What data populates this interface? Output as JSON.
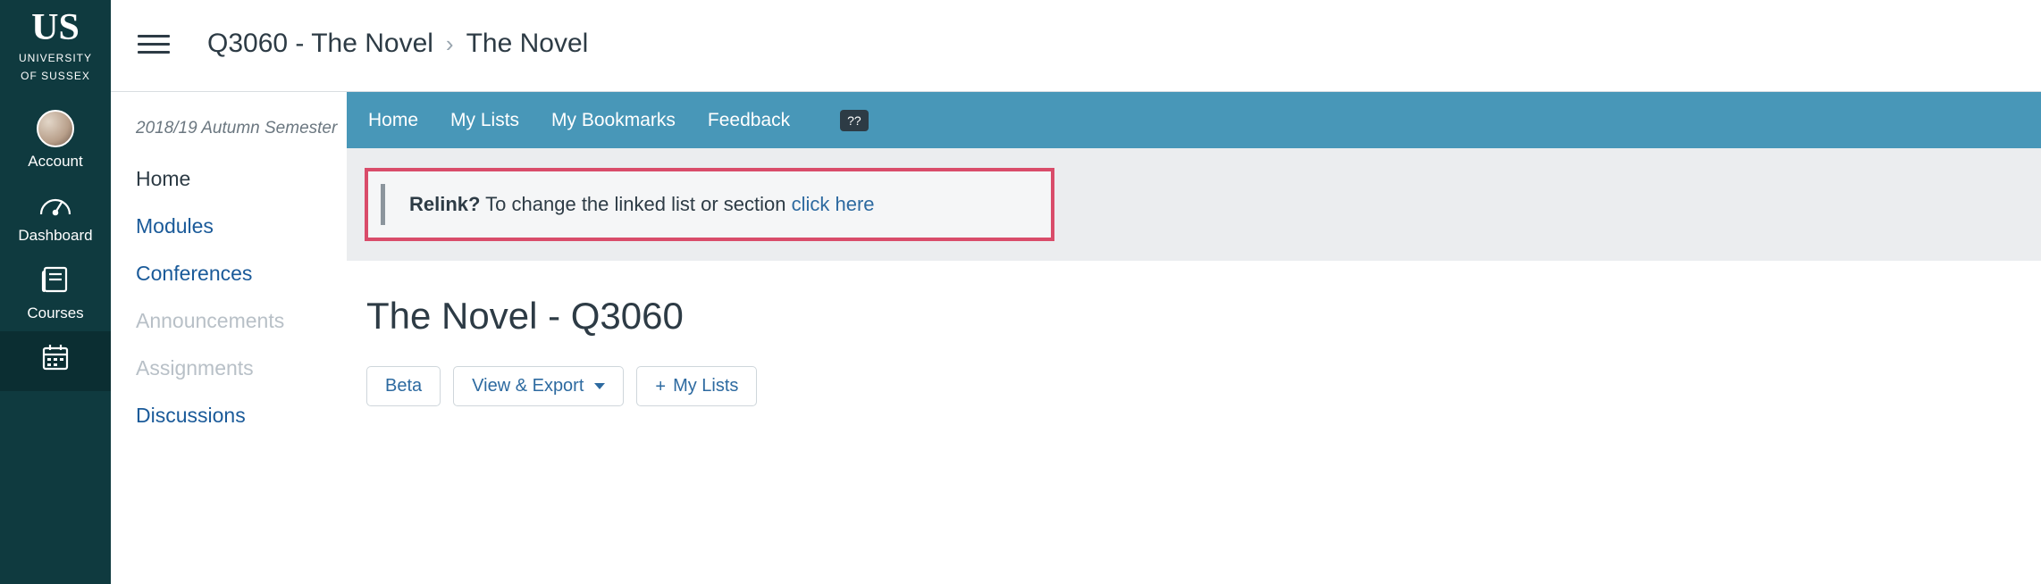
{
  "brand": {
    "logo_text": "US",
    "name_line1": "UNIVERSITY",
    "name_line2": "OF SUSSEX"
  },
  "global_nav": {
    "account": "Account",
    "dashboard": "Dashboard",
    "courses": "Courses"
  },
  "breadcrumb": {
    "course": "Q3060 - The Novel",
    "sep": "›",
    "page": "The Novel"
  },
  "course_nav": {
    "semester": "2018/19 Autumn Semester",
    "items": [
      {
        "label": "Home",
        "state": "selected"
      },
      {
        "label": "Modules",
        "state": "normal"
      },
      {
        "label": "Conferences",
        "state": "normal"
      },
      {
        "label": "Announcements",
        "state": "disabled"
      },
      {
        "label": "Assignments",
        "state": "disabled"
      },
      {
        "label": "Discussions",
        "state": "normal"
      }
    ]
  },
  "tool_nav": {
    "home": "Home",
    "mylists": "My Lists",
    "bookmarks": "My Bookmarks",
    "feedback": "Feedback",
    "help": "??"
  },
  "relink": {
    "bold": "Relink?",
    "msg": " To change the linked list or section ",
    "link": "click here"
  },
  "list": {
    "title": "The Novel - Q3060"
  },
  "actions": {
    "beta": "Beta",
    "view_export": "View & Export",
    "mylists": "My Lists"
  }
}
